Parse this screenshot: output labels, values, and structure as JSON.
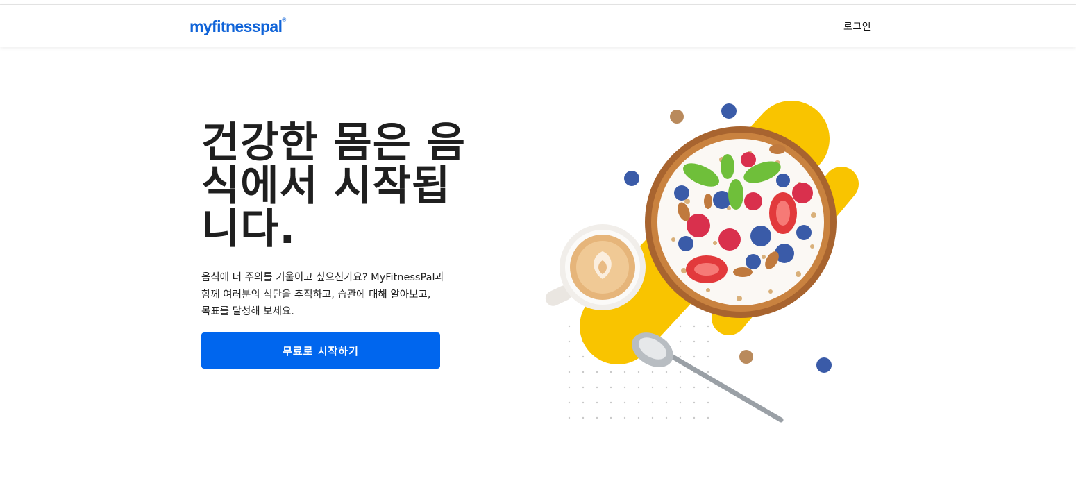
{
  "header": {
    "logo_text": "myfitnesspal",
    "logo_mark": "®",
    "login_label": "로그인"
  },
  "hero": {
    "title_line1": "건강한 몸은 음",
    "title_line2": "식에서 시작됩",
    "title_line3": "니다.",
    "description_line1": "음식에 더 주의를 기울이고 싶으신가요? MyFitnessPal과",
    "description_line2": "함께 여러분의 식단을 추적하고, 습관에 대해 알아보고,",
    "description_line3": "목표를 달성해 보세요.",
    "cta_label": "무료로 시작하기"
  },
  "colors": {
    "brand_blue": "#0066ee",
    "logo_blue": "#0f63d8",
    "accent_yellow": "#f9c400"
  },
  "illustration": {
    "icons": [
      "yogurt-bowl-icon",
      "coffee-cup-icon",
      "spoon-icon",
      "blueberry-icon",
      "walnut-icon",
      "mint-leaf-icon",
      "strawberry-icon",
      "raspberry-icon",
      "almond-icon"
    ]
  }
}
